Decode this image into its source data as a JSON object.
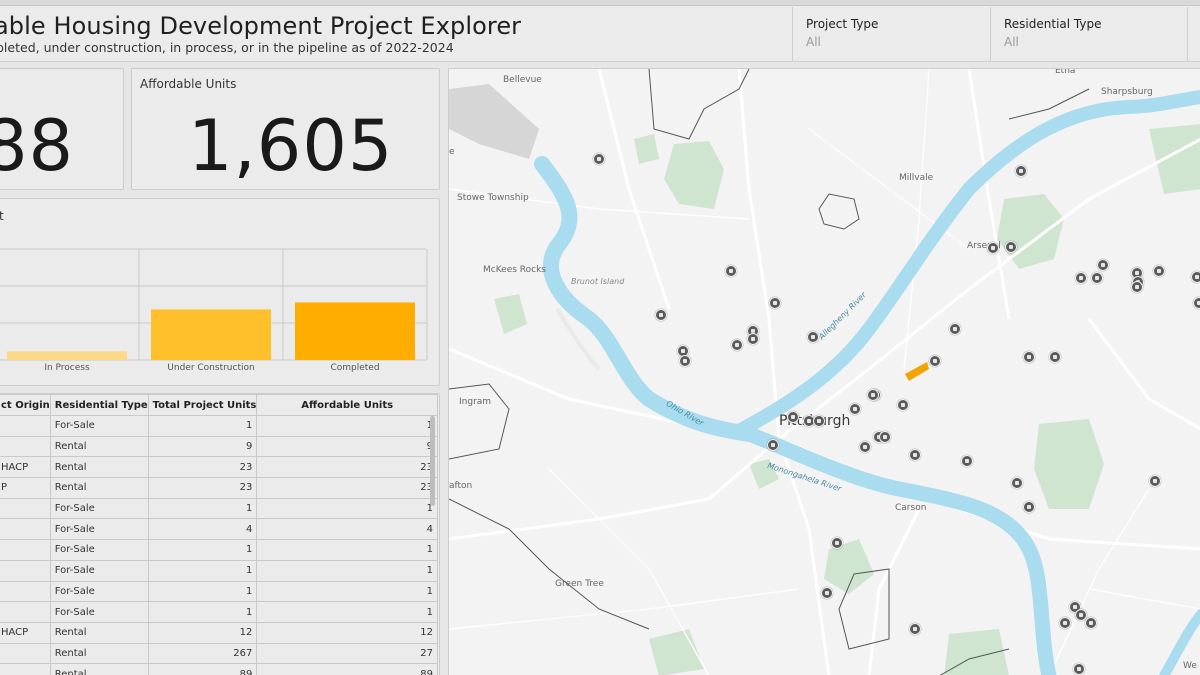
{
  "header": {
    "title": "able Housing Development Project Explorer",
    "subtitle": "pleted, under construction, in process, or in the pipeline as of 2022-2024"
  },
  "filters": [
    {
      "label": "Project Type",
      "value": "All"
    },
    {
      "label": "Residential Type",
      "value": "All"
    }
  ],
  "kpis": {
    "left_value": "88",
    "affordable_label": "Affordable Units",
    "affordable_value": "1,605"
  },
  "chart_label": "t",
  "chart_data": {
    "type": "bar",
    "categories": [
      "In Process",
      "Under Construction",
      "Completed"
    ],
    "values": [
      10,
      58,
      66
    ],
    "colors": [
      "#fdd987",
      "#ffc02b",
      "#ffad00"
    ],
    "ylim": [
      0,
      140
    ],
    "grid": true
  },
  "table": {
    "columns": [
      "ct Origin",
      "Residential Type",
      "Total Project Units",
      "Affordable Units"
    ],
    "rows": [
      [
        "",
        "For-Sale",
        "1",
        "1"
      ],
      [
        "",
        "Rental",
        "9",
        "9"
      ],
      [
        "HACP",
        "Rental",
        "23",
        "23"
      ],
      [
        "P",
        "Rental",
        "23",
        "23"
      ],
      [
        "",
        "For-Sale",
        "1",
        "1"
      ],
      [
        "",
        "For-Sale",
        "4",
        "4"
      ],
      [
        "",
        "For-Sale",
        "1",
        "1"
      ],
      [
        "",
        "For-Sale",
        "1",
        "1"
      ],
      [
        "",
        "For-Sale",
        "1",
        "1"
      ],
      [
        "",
        "For-Sale",
        "1",
        "1"
      ],
      [
        "HACP",
        "Rental",
        "12",
        "12"
      ],
      [
        "",
        "Rental",
        "267",
        "27"
      ],
      [
        "",
        "Rental",
        "89",
        "89"
      ]
    ]
  },
  "map": {
    "labels": [
      {
        "name": "Bellevue",
        "cls": ""
      },
      {
        "name": "Etna",
        "cls": ""
      },
      {
        "name": "Sharpsburg",
        "cls": ""
      },
      {
        "name": "Stowe Township",
        "cls": ""
      },
      {
        "name": "Millvale",
        "cls": ""
      },
      {
        "name": "Arsenal",
        "cls": ""
      },
      {
        "name": "McKees Rocks",
        "cls": ""
      },
      {
        "name": "Brunot Island",
        "cls": "island"
      },
      {
        "name": "Ingram",
        "cls": ""
      },
      {
        "name": "Pittsburgh",
        "cls": "big"
      },
      {
        "name": "Allegheny River",
        "cls": "river"
      },
      {
        "name": "Ohio River",
        "cls": "river"
      },
      {
        "name": "Monongahela River",
        "cls": "river"
      },
      {
        "name": "afton",
        "cls": ""
      },
      {
        "name": "Carson",
        "cls": ""
      },
      {
        "name": "Green Tree",
        "cls": ""
      },
      {
        "name": "We",
        "cls": ""
      },
      {
        "name": "e",
        "cls": ""
      }
    ]
  }
}
